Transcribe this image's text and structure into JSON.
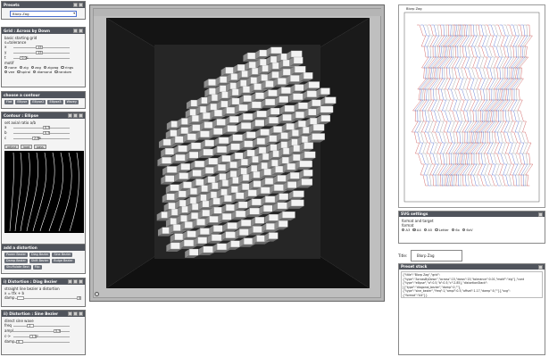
{
  "presets": {
    "title": "Presets",
    "selected": "Blorp Zag"
  },
  "grid": {
    "title": "Grid : Across by Down",
    "desc1": "basic starting grid",
    "desc2": "s=tolerance",
    "sliders": [
      {
        "label": "x",
        "value": "15",
        "fill": 0.42
      },
      {
        "label": "y",
        "value": "15",
        "fill": 0.42
      },
      {
        "label": "t",
        "value": "0.01",
        "fill": 0.12
      }
    ],
    "motif_label": "motif",
    "motifs": [
      {
        "label": "none",
        "on": false
      },
      {
        "label": "zig",
        "on": true
      },
      {
        "label": "zag",
        "on": false
      },
      {
        "label": "zigzag",
        "on": false
      },
      {
        "label": "rings",
        "on": false
      },
      {
        "label": "vee",
        "on": false
      },
      {
        "label": "spiral",
        "on": false
      },
      {
        "label": "diamond",
        "on": false
      },
      {
        "label": "random",
        "on": false
      }
    ]
  },
  "choose_contour": {
    "title": "choose a contour",
    "buttons": [
      "Flat",
      "Ellipse",
      "Ellipse2",
      "Ellipse3",
      "Wavey"
    ]
  },
  "contour": {
    "title": "Contour : Ellipse",
    "desc": "set axial ratio a/b",
    "sliders": [
      {
        "label": "a",
        "value": "0.5",
        "fill": 0.55
      },
      {
        "label": "b",
        "value": "0.5",
        "fill": 0.55
      },
      {
        "label": "c",
        "value": "2.85",
        "fill": 0.35
      }
    ],
    "canvas_buttons": [
      "adjust",
      "load",
      "pass"
    ]
  },
  "distortions": {
    "title": "add a distortion",
    "buttons": [
      "Power Bezier",
      "Diag Bezier",
      "Sine Bezier",
      "Damp Bezier",
      "Shift Bezier",
      "Bulge Bezier",
      "Shuffulate Bezi",
      "Flip"
    ]
  },
  "diag_bezier": {
    "title": "i) Distortion : Diag Bezier",
    "desc1": "straight line bezier a distortion",
    "desc2": "x = tfx + b",
    "slider_label": "damp",
    "slider_value": "0",
    "fill": 0.02
  },
  "sine_bezier": {
    "title": "ii) Distortion : Sine Bezier",
    "desc": "direct sine wave",
    "sliders": [
      {
        "label": "freq",
        "value": "1",
        "fill": 0.25
      },
      {
        "label": "ampl",
        "value": "0.5",
        "fill": 0.75
      },
      {
        "label": "c->",
        "value": "1.17",
        "fill": 0.3
      },
      {
        "label": "damp",
        "value": "0",
        "fill": 0.05
      }
    ]
  },
  "preview": {
    "title": "Blorp Zag"
  },
  "svg_settings": {
    "title": "SVG settings",
    "desc": "format and target",
    "format_label": "format",
    "formats": [
      {
        "label": "A3",
        "on": false
      },
      {
        "label": "A4",
        "on": true
      },
      {
        "label": "A5",
        "on": false
      },
      {
        "label": "Letter",
        "on": false
      },
      {
        "label": "6x",
        "on": false
      },
      {
        "label": "6xV",
        "on": false
      }
    ]
  },
  "title_field": {
    "label": "Title:",
    "value": "Blorp Zag"
  },
  "preset_stack": {
    "title": "Preset stack",
    "lines": [
      "{\"title\":\"Blorp Zag\",\"grid\":",
      "{\"type\":\"AcrossByDown\",\"across\":15,\"down\":15,\"tolerance\":0.01,\"motif\":\"zig\"},\"cont",
      "{\"type\":\"ellipse\",\"a\":0.5,\"b\":0.5,\"c\":2.85},\"distortionStack\":",
      "[{\"type\":\"diagonal_bezier\",\"damp\":0,\"\"},",
      "{\"type\":\"sine_bezier\",\"freq\":1,\"ampl\":0.5,\"offset\":1.17,\"damp\":0,\"\"}],\"svg\":",
      "{\"format\":\"A4\"}}"
    ]
  }
}
